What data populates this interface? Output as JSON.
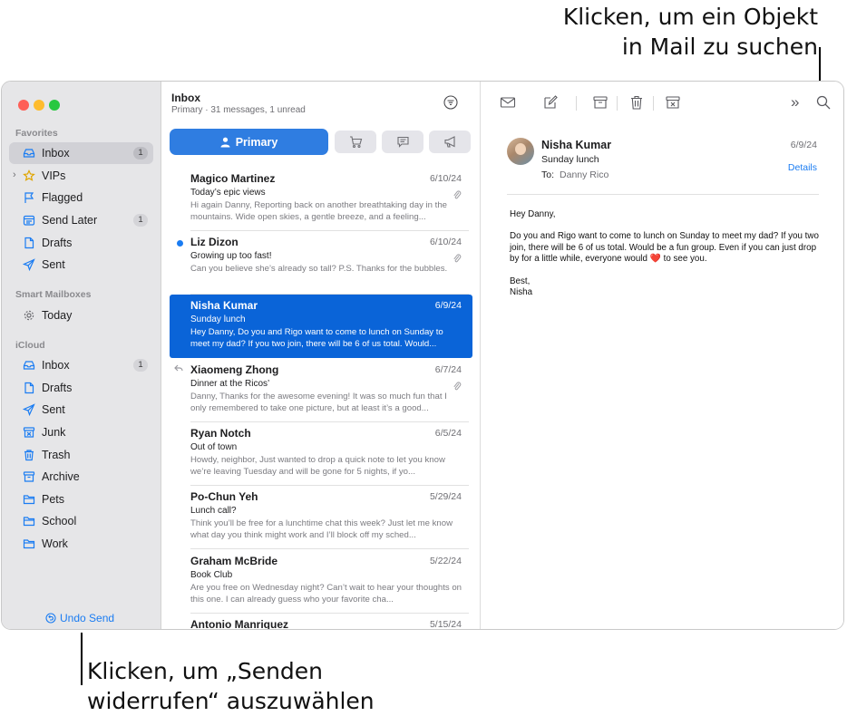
{
  "callouts": {
    "top_line1": "Klicken, um ein Objekt",
    "top_line2": "in Mail zu suchen",
    "bottom_line1": "Klicken, um „Senden",
    "bottom_line2": "widerrufen“ auszuwählen"
  },
  "sidebar": {
    "favorites_label": "Favorites",
    "favorites": [
      {
        "label": "Inbox",
        "icon": "inbox-icon",
        "badge": "1",
        "selected": true
      },
      {
        "label": "VIPs",
        "icon": "star-icon",
        "badge": "",
        "has_chevron": true
      },
      {
        "label": "Flagged",
        "icon": "flag-icon",
        "badge": ""
      },
      {
        "label": "Send Later",
        "icon": "send-later-icon",
        "badge": "1"
      },
      {
        "label": "Drafts",
        "icon": "document-icon",
        "badge": ""
      },
      {
        "label": "Sent",
        "icon": "paperplane-icon",
        "badge": ""
      }
    ],
    "smart_label": "Smart Mailboxes",
    "smart": [
      {
        "label": "Today",
        "icon": "gear-icon"
      }
    ],
    "icloud_label": "iCloud",
    "icloud": [
      {
        "label": "Inbox",
        "icon": "inbox-icon",
        "badge": "1"
      },
      {
        "label": "Drafts",
        "icon": "document-icon",
        "badge": ""
      },
      {
        "label": "Sent",
        "icon": "paperplane-icon",
        "badge": ""
      },
      {
        "label": "Junk",
        "icon": "junk-icon",
        "badge": ""
      },
      {
        "label": "Trash",
        "icon": "trash-icon",
        "badge": ""
      },
      {
        "label": "Archive",
        "icon": "archive-icon",
        "badge": ""
      },
      {
        "label": "Pets",
        "icon": "folder-icon",
        "badge": ""
      },
      {
        "label": "School",
        "icon": "folder-icon",
        "badge": ""
      },
      {
        "label": "Work",
        "icon": "folder-icon",
        "badge": ""
      }
    ],
    "chevron": "›",
    "undo_send": "Undo Send"
  },
  "list": {
    "title": "Inbox",
    "subtitle": "Primary · 31 messages, 1 unread",
    "primary_tab": "Primary",
    "messages": [
      {
        "sender": "Magico Martinez",
        "date": "6/10/24",
        "subject": "Today’s epic views",
        "preview": "Hi again Danny, Reporting back on another breathtaking day in the mountains. Wide open skies, a gentle breeze, and a feeling...",
        "attachment": true
      },
      {
        "sender": "Liz Dizon",
        "date": "6/10/24",
        "subject": "Growing up too fast!",
        "preview": "Can you believe she’s already so tall? P.S. Thanks for the bubbles.",
        "attachment": true,
        "unread": true
      },
      {
        "sender": "Nisha Kumar",
        "date": "6/9/24",
        "subject": "Sunday lunch",
        "preview": "Hey Danny, Do you and Rigo want to come to lunch on Sunday to meet my dad? If you two join, there will be 6 of us total. Would...",
        "selected": true
      },
      {
        "sender": "Xiaomeng Zhong",
        "date": "6/7/24",
        "subject": "Dinner at the Ricos’",
        "preview": "Danny, Thanks for the awesome evening! It was so much fun that I only remembered to take one picture, but at least it’s a good...",
        "attachment": true,
        "replied": true
      },
      {
        "sender": "Ryan Notch",
        "date": "6/5/24",
        "subject": "Out of town",
        "preview": "Howdy, neighbor, Just wanted to drop a quick note to let you know we’re leaving Tuesday and will be gone for 5 nights, if yo..."
      },
      {
        "sender": "Po-Chun Yeh",
        "date": "5/29/24",
        "subject": "Lunch call?",
        "preview": "Think you’ll be free for a lunchtime chat this week? Just let me know what day you think might work and I’ll block off my sched..."
      },
      {
        "sender": "Graham McBride",
        "date": "5/22/24",
        "subject": "Book Club",
        "preview": "Are you free on Wednesday night? Can’t wait to hear your thoughts on this one. I can already guess who your favorite cha..."
      },
      {
        "sender": "Antonio Manriquez",
        "date": "5/15/24",
        "subject": "",
        "preview": ""
      }
    ]
  },
  "reader": {
    "from": "Nisha Kumar",
    "subject": "Sunday lunch",
    "to_label": "To:",
    "to": "Danny Rico",
    "date": "6/9/24",
    "details": "Details",
    "greeting": "Hey Danny,",
    "body_before_heart": "Do you and Rigo want to come to lunch on Sunday to meet my dad? If you two join, there will be 6 of us total. Would be a fun group. Even if you can just drop by for a little while, everyone would",
    "heart": "❤️",
    "body_after_heart": "to see you.",
    "closing": "Best,",
    "signature": "Nisha"
  },
  "toolbar": {
    "more": "»"
  },
  "colors": {
    "accent": "#1a7cf2",
    "selected_row": "#0a64d8",
    "primary_tab": "#2f7de1",
    "sidebar_bg": "#e6e6e8"
  }
}
